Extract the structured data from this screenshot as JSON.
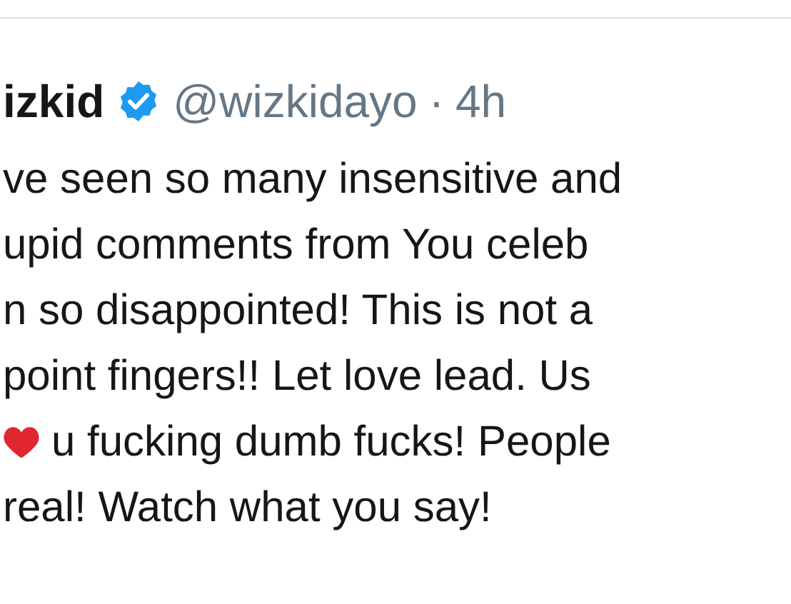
{
  "tweet": {
    "display_name": "izkid",
    "verified": true,
    "handle": "@wizkidayo",
    "separator": "·",
    "time": "4h",
    "lines": [
      {
        "text": "ve seen so many insensitive and",
        "emoji": false
      },
      {
        "text": "upid comments from You celeb",
        "emoji": false
      },
      {
        "text": "n so disappointed! This is not a",
        "emoji": false
      },
      {
        "text": "point fingers!! Let love lead. Us",
        "emoji": false
      },
      {
        "text": "u fucking dumb fucks! People",
        "emoji": true
      },
      {
        "text": "real! Watch what you say!",
        "emoji": false
      }
    ]
  }
}
